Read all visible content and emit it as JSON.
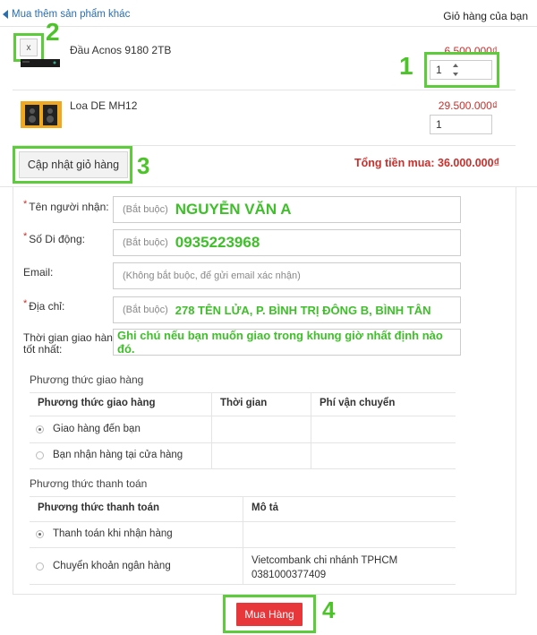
{
  "header": {
    "back_link": "Mua thêm sản phẩm khác",
    "cart_title": "Giỏ hàng của bạn"
  },
  "cart": {
    "remove_label": "x",
    "items": [
      {
        "name": "Đầu Acnos 9180 2TB",
        "price": "6.500.000₫",
        "qty": "1"
      },
      {
        "name": "Loa DE MH12",
        "price": "29.500.000₫",
        "qty": "1"
      }
    ],
    "update_button": "Cập nhật giỏ hàng",
    "total": "Tổng tiền mua: 36.000.000₫"
  },
  "form": {
    "name_label": "Tên người nhận:",
    "name_placeholder": "(Bắt buộc)",
    "name_value": "NGUYỄN VĂN A",
    "phone_label": "Số Di động:",
    "phone_placeholder": "(Bắt buộc)",
    "phone_value": "0935223968",
    "email_label": "Email:",
    "email_placeholder": "(Không bắt buộc, để gửi email xác nhận)",
    "address_label": "Địa chỉ:",
    "address_placeholder": "(Bắt buộc)",
    "address_value": "278 TÊN LỬA, P. BÌNH TRỊ ĐÔNG B, BÌNH TÂN",
    "time_label_line1": "Thời gian giao hàng",
    "time_label_line2": "tốt nhất:",
    "time_value": "Ghi chú nếu bạn muốn giao trong khung giờ nhất định nào đó.",
    "required_mark": "*"
  },
  "shipping": {
    "section_title": "Phương thức giao hàng",
    "headers": [
      "Phương thức giao hàng",
      "Thời gian",
      "Phí vận chuyển"
    ],
    "options": [
      {
        "label": "Giao hàng đến bạn",
        "selected": true
      },
      {
        "label": "Bạn nhận hàng tại cửa hàng",
        "selected": false
      }
    ]
  },
  "payment": {
    "section_title": "Phương thức thanh toán",
    "headers": [
      "Phương thức thanh toán",
      "Mô tả"
    ],
    "options": [
      {
        "label": "Thanh toán khi nhận hàng",
        "desc_line1": "",
        "desc_line2": "",
        "selected": true
      },
      {
        "label": "Chuyển khoản ngân hàng",
        "desc_line1": "Vietcombank chi nhánh TPHCM",
        "desc_line2": "0381000377409",
        "selected": false
      }
    ]
  },
  "submit": {
    "label": "Mua Hàng"
  },
  "annotations": {
    "n1": "1",
    "n2": "2",
    "n3": "3",
    "n4": "4"
  },
  "colors": {
    "price": "#c9302c",
    "highlight": "#5ccc3a",
    "buy": "#e8373a",
    "link": "#2a6fb0"
  }
}
